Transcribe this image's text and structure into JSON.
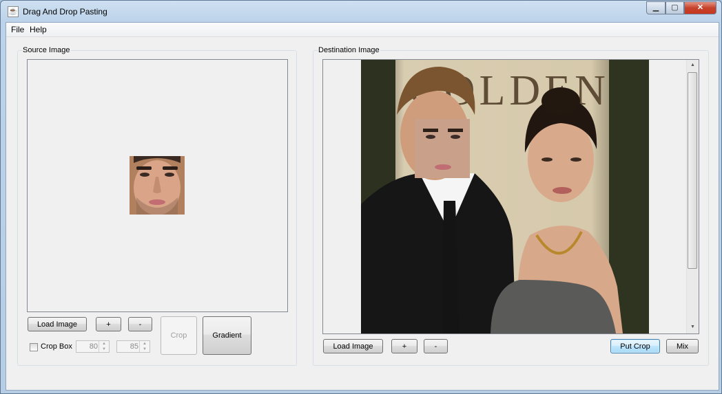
{
  "window": {
    "title": "Drag And Drop Pasting",
    "icon": "java-icon"
  },
  "menu": {
    "file": "File",
    "help": "Help"
  },
  "source": {
    "group_label": "Source Image",
    "load_image": "Load Image",
    "zoom_in": "+",
    "zoom_out": "-",
    "crop": "Crop",
    "gradient": "Gradient",
    "crop_box_label": "Crop Box",
    "crop_box_checked": false,
    "crop_width": "80",
    "crop_height": "85"
  },
  "destination": {
    "group_label": "Destination Image",
    "load_image": "Load Image",
    "zoom_in": "+",
    "zoom_out": "-",
    "put_crop": "Put Crop",
    "mix": "Mix",
    "sign_text": "GOLDEN"
  }
}
